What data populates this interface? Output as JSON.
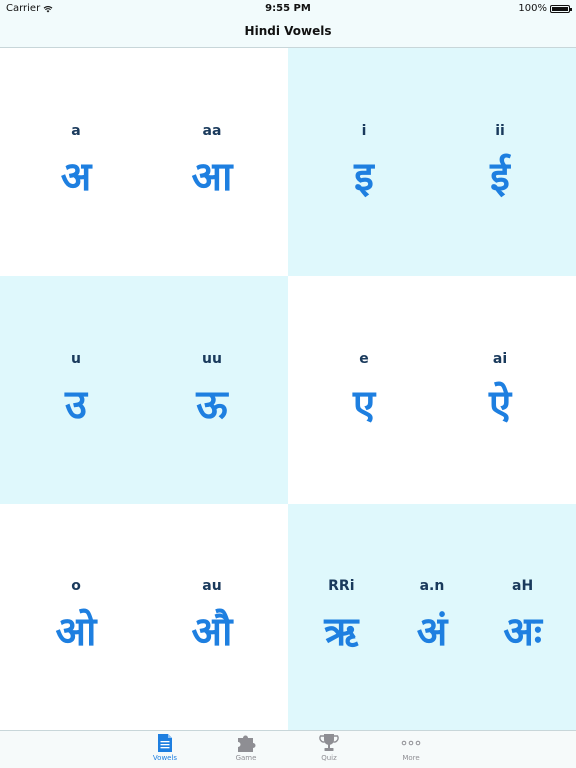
{
  "status_bar": {
    "carrier": "Carrier",
    "time": "9:55 PM",
    "battery": "100%"
  },
  "nav": {
    "title": "Hindi Vowels"
  },
  "cells": [
    {
      "vowels": [
        {
          "roman": "a",
          "letter": "अ"
        },
        {
          "roman": "aa",
          "letter": "आ"
        }
      ]
    },
    {
      "vowels": [
        {
          "roman": "i",
          "letter": "इ"
        },
        {
          "roman": "ii",
          "letter": "ई"
        }
      ]
    },
    {
      "vowels": [
        {
          "roman": "u",
          "letter": "उ"
        },
        {
          "roman": "uu",
          "letter": "ऊ"
        }
      ]
    },
    {
      "vowels": [
        {
          "roman": "e",
          "letter": "ए"
        },
        {
          "roman": "ai",
          "letter": "ऐ"
        }
      ]
    },
    {
      "vowels": [
        {
          "roman": "o",
          "letter": "ओ"
        },
        {
          "roman": "au",
          "letter": "औ"
        }
      ]
    },
    {
      "vowels": [
        {
          "roman": "RRi",
          "letter": "ऋ"
        },
        {
          "roman": "a.n",
          "letter": "अं"
        },
        {
          "roman": "aH",
          "letter": "अः"
        }
      ]
    }
  ],
  "tabs": [
    {
      "label": "Vowels",
      "icon": "document-icon",
      "active": true
    },
    {
      "label": "Game",
      "icon": "puzzle-icon",
      "active": false
    },
    {
      "label": "Quiz",
      "icon": "trophy-icon",
      "active": false
    },
    {
      "label": "More",
      "icon": "more-icon",
      "active": false
    }
  ],
  "colors": {
    "accent": "#1e7fe0",
    "cell_cyan": "#dff8fc",
    "roman_text": "#1a3a5c",
    "bar_background": "#f2fbfc"
  }
}
